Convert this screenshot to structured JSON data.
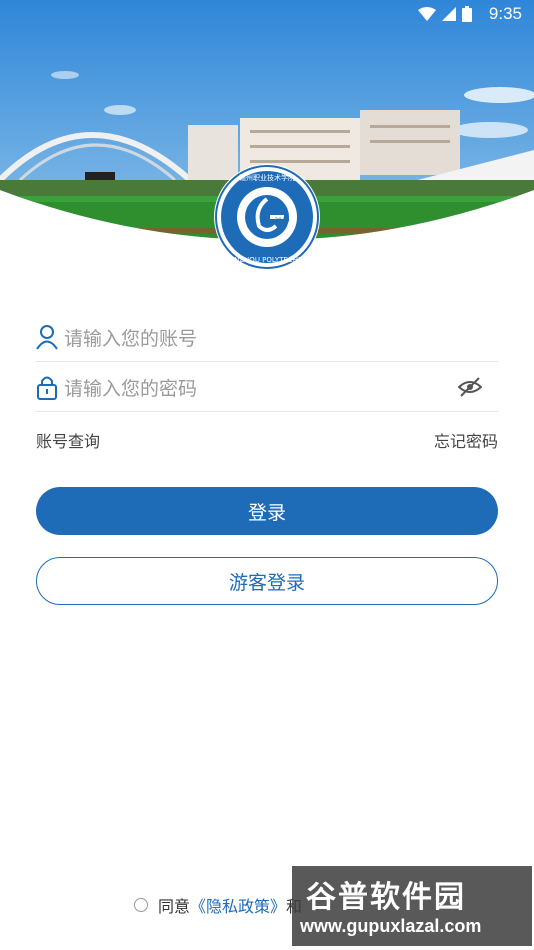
{
  "status_bar": {
    "time": "9:35"
  },
  "logo": {
    "year": "2019",
    "english_name": "GANZHOU POLYTECHNIC",
    "chinese_name": "赣州职业技术学院"
  },
  "login_form": {
    "account_placeholder": "请输入您的账号",
    "password_placeholder": "请输入您的密码",
    "account_lookup_label": "账号查询",
    "forgot_password_label": "忘记密码",
    "login_button_label": "登录",
    "guest_login_button_label": "游客登录"
  },
  "agreement": {
    "prefix": "同意",
    "policy_link": "《隐私政策》",
    "suffix": "和"
  },
  "watermark": {
    "line1": "谷普软件园",
    "line2": "www.gupuxlazal.com"
  },
  "colors": {
    "primary": "#1e6bb8",
    "placeholder": "#9a9a9a",
    "sky": "#3f8fd6",
    "grass": "#2f8f2f"
  },
  "icons": [
    "user-icon",
    "lock-icon",
    "eye-off-icon",
    "wifi-icon",
    "signal-icon",
    "battery-icon"
  ]
}
